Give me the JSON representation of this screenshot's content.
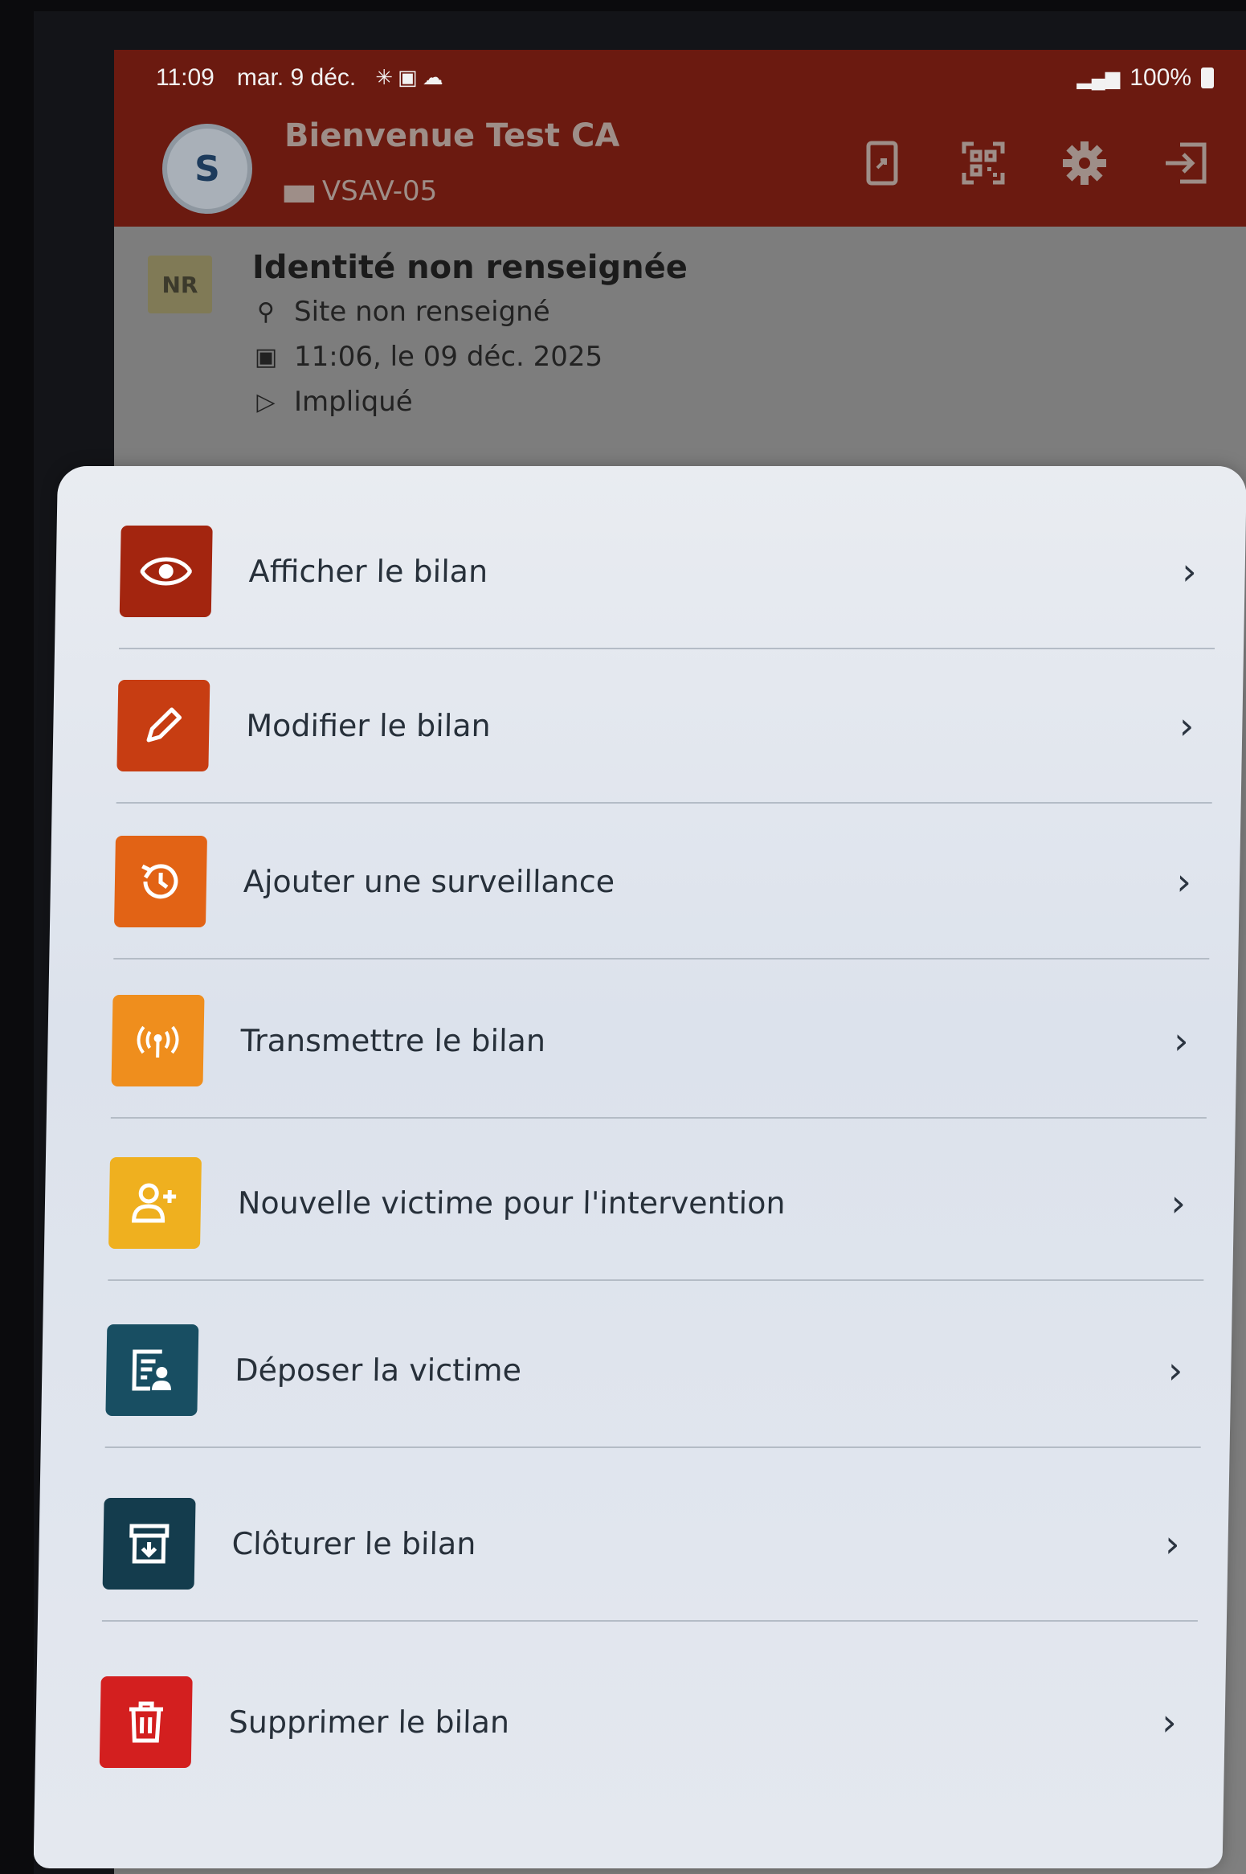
{
  "status_bar": {
    "time": "11:09",
    "date": "mar. 9 déc.",
    "battery": "100%"
  },
  "header": {
    "avatar_letter": "S",
    "welcome": "Bienvenue Test CA",
    "vehicle": "VSAV-05",
    "brand_color": "#6b1a10"
  },
  "victim_card": {
    "badge": "NR",
    "title": "Identité non renseignée",
    "site": "Site non renseigné",
    "datetime": "11:06, le 09 déc. 2025",
    "status": "Impliqué"
  },
  "menu": {
    "items": [
      {
        "label": "Afficher le bilan",
        "icon": "eye-icon",
        "color": "#a3250f"
      },
      {
        "label": "Modifier le bilan",
        "icon": "pencil-icon",
        "color": "#c73d12"
      },
      {
        "label": "Ajouter une surveillance",
        "icon": "history-icon",
        "color": "#e26315"
      },
      {
        "label": "Transmettre le bilan",
        "icon": "antenna-icon",
        "color": "#ef8e1d"
      },
      {
        "label": "Nouvelle victime pour l'intervention",
        "icon": "add-person-icon",
        "color": "#efb01f"
      },
      {
        "label": "Déposer la victime",
        "icon": "patient-form-icon",
        "color": "#184e62"
      },
      {
        "label": "Clôturer le bilan",
        "icon": "archive-icon",
        "color": "#143c4d"
      },
      {
        "label": "Supprimer le bilan",
        "icon": "trash-icon",
        "color": "#d31f1f"
      }
    ]
  }
}
